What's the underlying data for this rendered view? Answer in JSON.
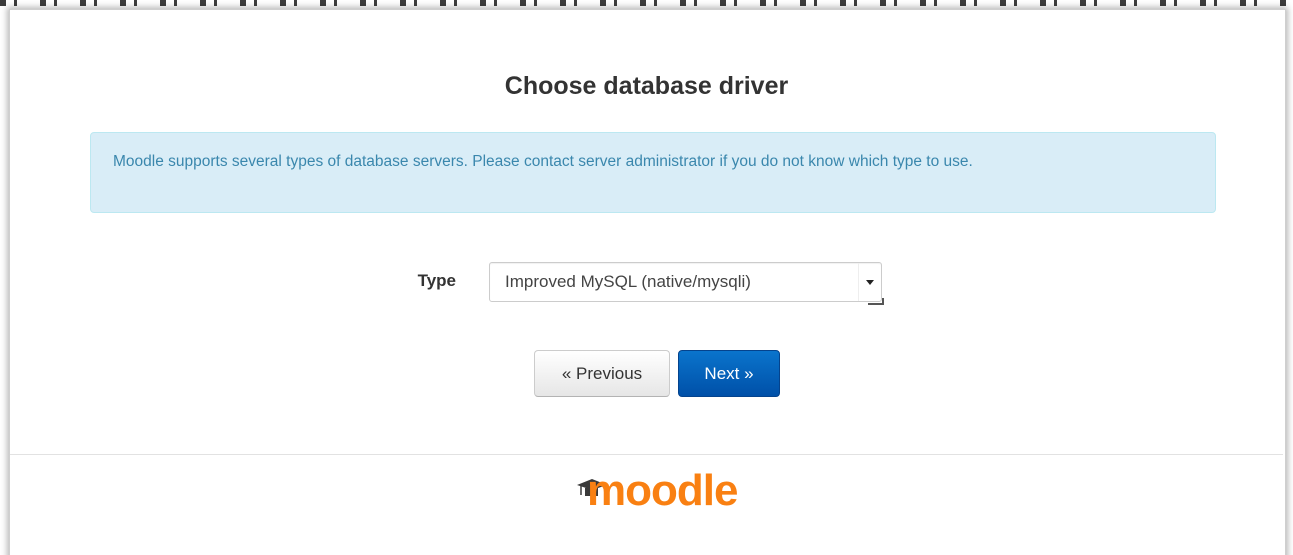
{
  "page": {
    "heading": "Choose database driver",
    "info_message": "Moodle supports several types of database servers. Please contact server administrator if you do not know which type to use."
  },
  "form": {
    "type_label": "Type",
    "type_selected": "Improved MySQL (native/mysqli)"
  },
  "buttons": {
    "previous_label": "« Previous",
    "next_label": "Next »"
  },
  "footer": {
    "logo_text": "moodle"
  },
  "colors": {
    "alert_bg": "#d9edf7",
    "alert_text": "#3a87ad",
    "primary_button": "#0a5fb8",
    "logo_orange": "#f98012"
  },
  "icons": {
    "select_arrow": "caret-down-icon",
    "logo_hat": "graduation-cap-icon"
  }
}
